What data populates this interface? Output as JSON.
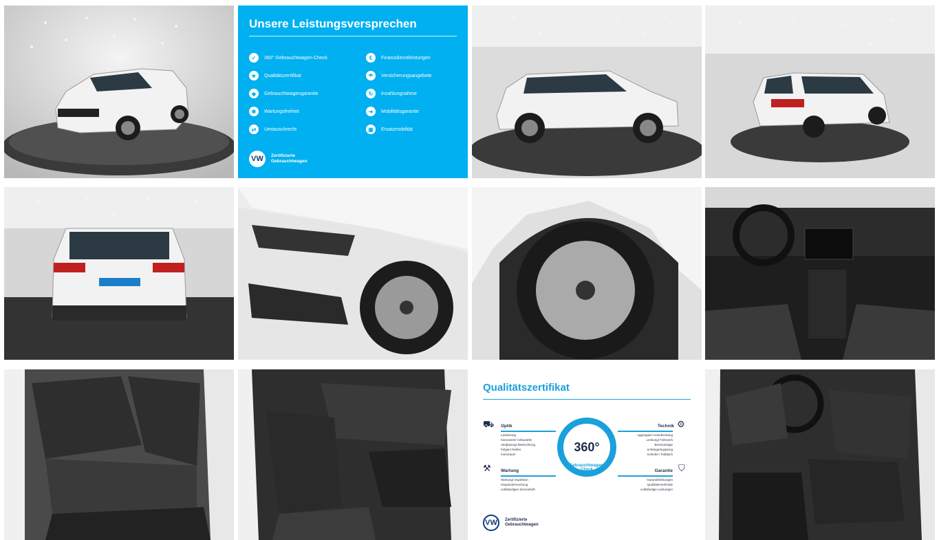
{
  "gallery": {
    "photos": [
      {
        "name": "photo-front-three-quarter"
      },
      {
        "name": "photo-side-profile"
      },
      {
        "name": "photo-rear-three-quarter"
      },
      {
        "name": "photo-rear"
      },
      {
        "name": "photo-front-wheel-headlight"
      },
      {
        "name": "photo-wheel-closeup"
      },
      {
        "name": "photo-cockpit"
      },
      {
        "name": "photo-rear-seats"
      },
      {
        "name": "photo-passenger-interior"
      },
      {
        "name": "photo-driver-interior"
      }
    ]
  },
  "leistungsversprechen": {
    "title": "Unsere Leistungsversprechen",
    "left_items": [
      "360° Gebrauchtwagen-Check",
      "Qualitätszertifikat",
      "Gebrauchtwagengarantie",
      "Wartungsfreiheit",
      "Umtauschrecht"
    ],
    "right_items": [
      "Finanzdienstleistungen",
      "Versicherungsangebote",
      "Inzahlungnahme",
      "Mobilitätsgarantie",
      "Ersatzmobilität"
    ],
    "footer_line1": "Zertifizierte",
    "footer_line2": "Gebrauchtwagen",
    "logo_text": "VW",
    "accent": "#00b0f0"
  },
  "qualitaetszertifikat": {
    "title": "Qualitätszertifikat",
    "badge_number": "360°",
    "badge_label": "Gebrauchtwagen-Check",
    "optik": {
      "label": "Optik",
      "items": [
        "Lackierung",
        "Karosserie/ Anbauteile",
        "Verglasung/ Beleuchtung",
        "Felgen/ Reifen",
        "Innenraum"
      ]
    },
    "wartung": {
      "label": "Wartung",
      "items": [
        "Wartung/ Inspektion",
        "Hauptuntersuchung",
        "vollständiges Serviceheft"
      ]
    },
    "technik": {
      "label": "Technik",
      "items": [
        "Aggregate/ Antriebsstrang",
        "Lenkung/ Fahrwerk",
        "Bremsanlage",
        "Anhängerkupplung",
        "Schiebe-/ Faltdach"
      ]
    },
    "garantie": {
      "label": "Garantie",
      "items": [
        "Garantieleistungen",
        "Qualitätsmerkmale",
        "vollständige Leistungen"
      ]
    },
    "footer_line1": "Zertifizierte",
    "footer_line2": "Gebrauchtwagen",
    "logo_text": "VW",
    "accent": "#1aa0dc"
  }
}
